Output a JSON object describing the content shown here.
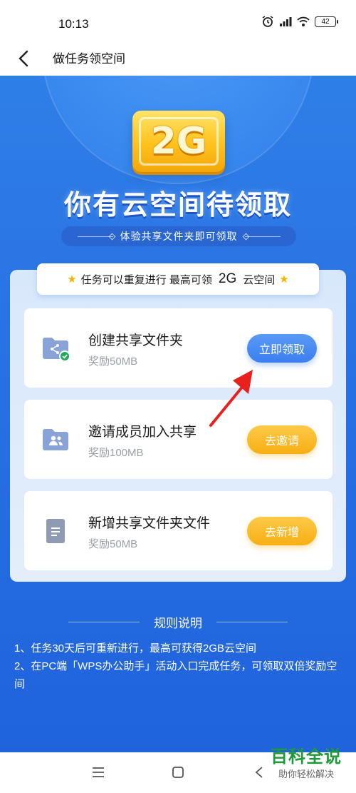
{
  "status": {
    "time": "10:13",
    "battery": "42"
  },
  "header": {
    "title": "做任务领空间"
  },
  "hero": {
    "badge": "2G",
    "title": "你有云空间待领取",
    "subtitle": "体验共享文件夹即可领取"
  },
  "tip": {
    "prefix": "任务可以重复进行 最高可领",
    "highlight": "2G",
    "suffix": "云空间"
  },
  "tasks": [
    {
      "title": "创建共享文件夹",
      "reward": "奖励50MB",
      "button": "立即领取",
      "icon": "shared-folder-done-icon"
    },
    {
      "title": "邀请成员加入共享",
      "reward": "奖励100MB",
      "button": "去邀请",
      "icon": "members-folder-icon"
    },
    {
      "title": "新增共享文件夹文件",
      "reward": "奖励50MB",
      "button": "去新增",
      "icon": "document-icon"
    }
  ],
  "rules": {
    "title": "规则说明",
    "items": [
      "1、任务30天后可重新进行，最高可获得2GB云空间",
      "2、在PC端「WPS办公助手」活动入口完成任务，可领取双倍奖励空间"
    ]
  },
  "watermark": {
    "title": "百科全说",
    "subtitle": "助你轻松解决"
  },
  "colors": {
    "primary_blue": "#2a73e3",
    "gold": "#f7af12",
    "annotation_red": "#e8201e"
  }
}
